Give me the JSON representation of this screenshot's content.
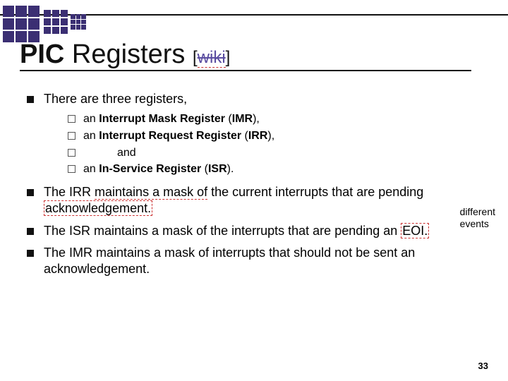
{
  "title_bold": "PIC",
  "title_rest": " Registers ",
  "wiki_bracket_l": "[",
  "wiki_label": "wiki",
  "wiki_bracket_r": "]",
  "b1": "There are three registers,",
  "sub1_pre": "an ",
  "sub1_bold": "Interrupt Mask Register",
  "sub1_post": " (",
  "sub1_abbr": "IMR",
  "sub1_close": "),",
  "sub2_pre": "an ",
  "sub2_bold": "Interrupt Request Register",
  "sub2_post": " (",
  "sub2_abbr": "IRR",
  "sub2_close": "),",
  "sub_and": "and",
  "sub3_pre": "an ",
  "sub3_bold": "In-Service Register",
  "sub3_post": " (",
  "sub3_abbr": "ISR",
  "sub3_close": ").",
  "b2a": "The IRR ",
  "b2b": "maintains a mask of",
  "b2c": " the current interrupts that are pending ",
  "b2d": "acknowledgement.",
  "b3a": "The ISR maintains a mask of the interrupts that are pending an ",
  "b3b": "EOI.",
  "b4": "The IMR maintains a mask of interrupts that should not be sent an acknowledgement.",
  "note1": "different",
  "note2": "events",
  "page": "33"
}
